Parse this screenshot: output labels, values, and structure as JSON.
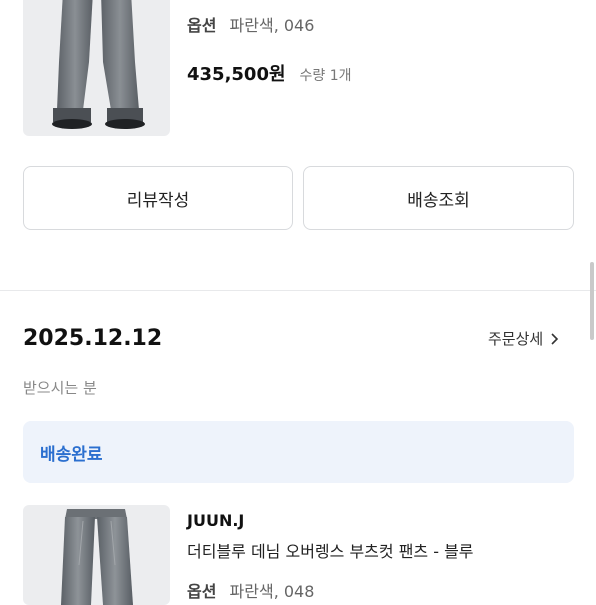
{
  "order1": {
    "option_label": "옵션",
    "option_value": "파란색, 046",
    "price": "435,500원",
    "quantity": "수량  1개",
    "buttons": {
      "review": "리뷰작성",
      "tracking": "배송조회"
    }
  },
  "order2": {
    "date": "2025.12.12",
    "detail_link": "주문상세",
    "recipient": "받으시는 분",
    "status": "배송완료",
    "brand": "JUUN.J",
    "product_name": "더티블루 데님 오버렝스 부츠컷 팬츠 - 블루",
    "option_label": "옵션",
    "option_value": "파란색, 048"
  },
  "colors": {
    "status_blue": "#2b6fcf",
    "status_bg": "#eef3fb",
    "divider": "#f1f2f4"
  },
  "icons": {
    "detail_chevron": "chevron-right-icon"
  }
}
